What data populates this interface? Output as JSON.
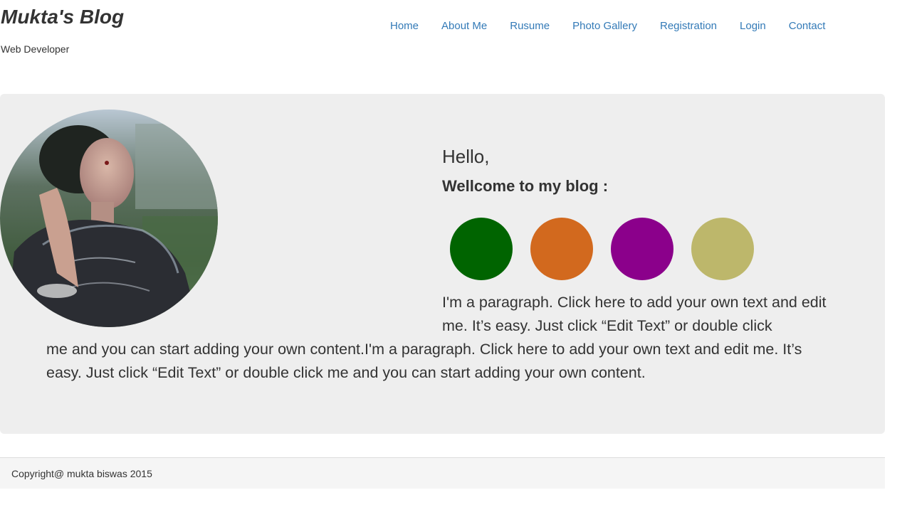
{
  "header": {
    "site_title": "Mukta's Blog",
    "tagline": "Web Developer"
  },
  "nav": {
    "items": [
      {
        "label": "Home"
      },
      {
        "label": "About Me"
      },
      {
        "label": "Rusume"
      },
      {
        "label": "Photo Gallery"
      },
      {
        "label": "Registration"
      },
      {
        "label": "Login"
      },
      {
        "label": "Contact"
      }
    ]
  },
  "hero": {
    "greeting": "Hello,",
    "welcome": "Wellcome to my blog :",
    "color_dots": [
      "#006400",
      "#d2691e",
      "#8b008b",
      "#bdb76b"
    ],
    "paragraph_line1": "I'm a paragraph. Click here to add your own text and edit me. It’s easy. Just click “Edit Text” or double click",
    "paragraph_rest": "me and you can start adding your own content.I'm a paragraph. Click here to add your own text and edit me. It’s easy. Just click “Edit Text” or double click me and you can start adding your own content."
  },
  "footer": {
    "copyright": "Copyright@ mukta biswas 2015"
  }
}
